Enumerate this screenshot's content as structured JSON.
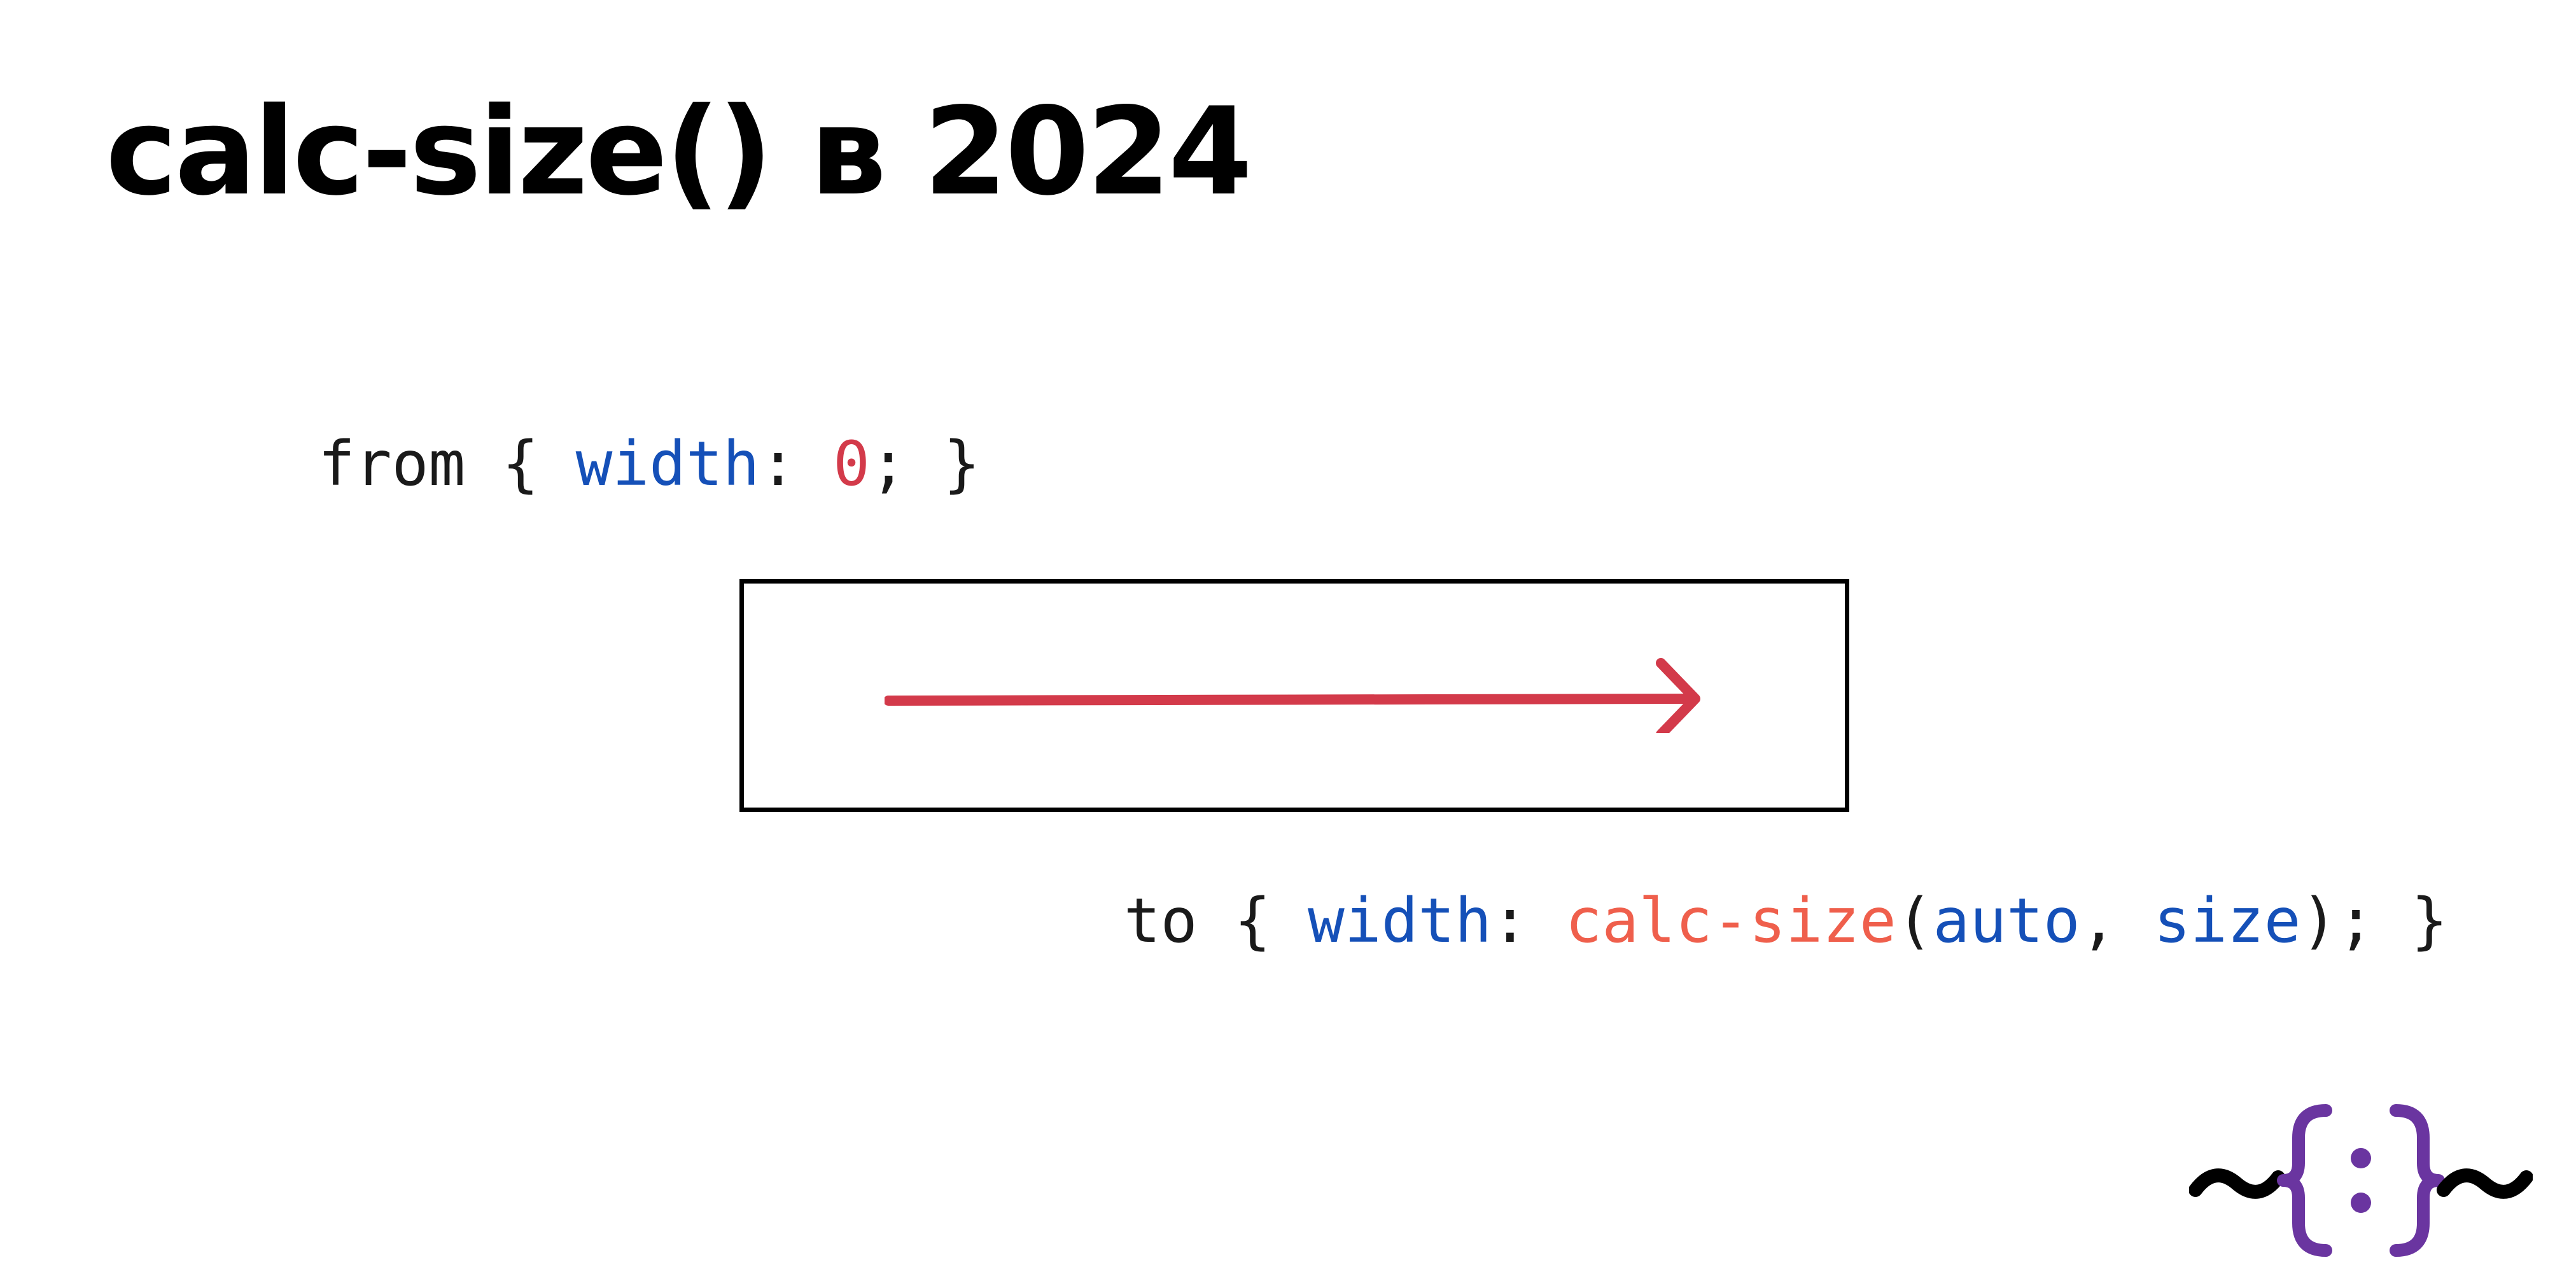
{
  "slide": {
    "title": "calc-size() в 2024"
  },
  "code": {
    "from": {
      "selector": "from",
      "open_brace": " { ",
      "property": "width",
      "colon": ": ",
      "value": "0",
      "close": "; }"
    },
    "to": {
      "selector": "to",
      "open_brace": " { ",
      "property": "width",
      "colon": ": ",
      "function": "calc-size",
      "paren_open": "(",
      "arg1": "auto",
      "comma": ", ",
      "arg2": "size",
      "close": "); }"
    }
  },
  "diagram": {
    "arrow_direction": "right",
    "arrow_color": "#d33a4a",
    "box_border_color": "#000000"
  },
  "logo": {
    "icon": "curly-brackets-tilde-logo",
    "glyph_color": "#000000",
    "brace_color": "#6a35a0"
  },
  "colors": {
    "property": "#1550b8",
    "number": "#d33a4a",
    "function": "#ef5f4c",
    "text": "#1a1a1a"
  }
}
